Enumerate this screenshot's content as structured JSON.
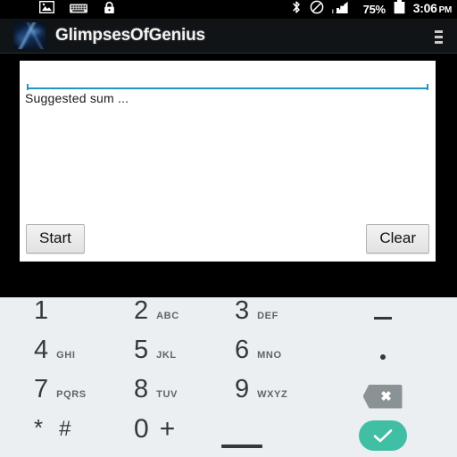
{
  "status_bar": {
    "left_icons": [
      {
        "name": "image-icon",
        "label": "image"
      },
      {
        "name": "keyboard-icon",
        "label": "keyboard"
      },
      {
        "name": "lock-icon",
        "label": "lock"
      }
    ],
    "right_icons": [
      {
        "name": "bluetooth-icon",
        "label": "bluetooth"
      },
      {
        "name": "do-not-disturb-icon",
        "label": "do not disturb"
      },
      {
        "name": "signal-bars-icon",
        "label": "signal"
      }
    ],
    "battery_percent": "75%",
    "clock_time": "3:06",
    "clock_ampm": "PM"
  },
  "app_bar": {
    "title": "GlimpsesOfGenius",
    "icon_name": "app-logo-icon",
    "overflow_label": "More options",
    "background_color": "#111417"
  },
  "content": {
    "input": {
      "value": "",
      "placeholder": "",
      "underline_color": "#2196c4"
    },
    "suggested_label": "Suggested sum ...",
    "start_button": "Start",
    "clear_button": "Clear",
    "panel_color": "#ffffff"
  },
  "keyboard": {
    "background_color": "#eceff1",
    "enter_color": "#40bfa5",
    "backspace_color": "#8a9296",
    "rows": [
      [
        {
          "digit": "1",
          "letters": ""
        },
        {
          "digit": "2",
          "letters": "ABC"
        },
        {
          "digit": "3",
          "letters": "DEF"
        },
        {
          "special": "minus",
          "label": "-"
        }
      ],
      [
        {
          "digit": "4",
          "letters": "GHI"
        },
        {
          "digit": "5",
          "letters": "JKL"
        },
        {
          "digit": "6",
          "letters": "MNO"
        },
        {
          "special": "period",
          "label": "."
        }
      ],
      [
        {
          "digit": "7",
          "letters": "PQRS"
        },
        {
          "digit": "8",
          "letters": "TUV"
        },
        {
          "digit": "9",
          "letters": "WXYZ"
        },
        {
          "special": "backspace",
          "label": "backspace"
        }
      ],
      [
        {
          "digit": "*",
          "letters": "",
          "extra": "#"
        },
        {
          "digit": "0",
          "letters": "",
          "extra": "+"
        },
        {
          "special": "space",
          "label": "space"
        },
        {
          "special": "enter",
          "label": "enter"
        }
      ]
    ]
  }
}
